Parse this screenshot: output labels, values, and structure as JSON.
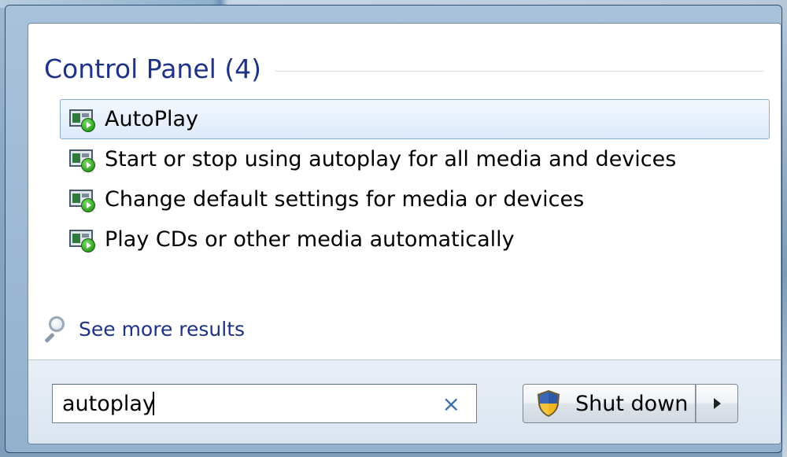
{
  "results": {
    "group_title": "Control Panel (4)",
    "items": [
      {
        "label": "AutoPlay",
        "icon": "autoplay-icon",
        "selected": true
      },
      {
        "label": "Start or stop using autoplay for all media and devices",
        "icon": "autoplay-icon",
        "selected": false
      },
      {
        "label": "Change default settings for media or devices",
        "icon": "autoplay-icon",
        "selected": false
      },
      {
        "label": "Play CDs or other media automatically",
        "icon": "autoplay-icon",
        "selected": false
      }
    ],
    "see_more": "See more results"
  },
  "search": {
    "value": "autoplay",
    "clear_glyph": "×"
  },
  "shutdown": {
    "label": "Shut down",
    "icon": "uac-shield-icon"
  },
  "colors": {
    "link": "#1e3287",
    "selection_border": "#84acdd",
    "clear_icon": "#3d6fb0"
  }
}
